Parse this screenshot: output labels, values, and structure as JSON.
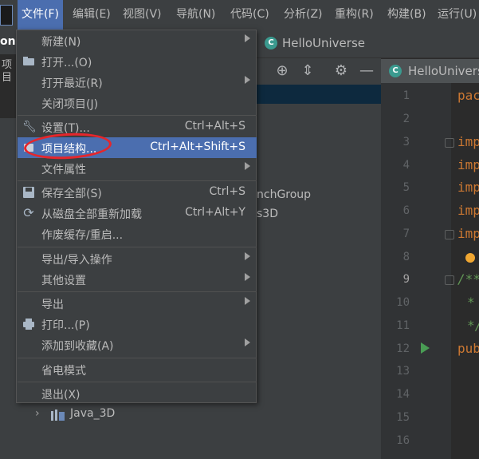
{
  "menubar": {
    "items": [
      "文件(F)",
      "编辑(E)",
      "视图(V)",
      "导航(N)",
      "代码(C)",
      "分析(Z)",
      "重构(R)",
      "构建(B)",
      "运行(U)"
    ],
    "active_index": 0
  },
  "left_strip": {
    "on_label": "on",
    "tab_label": "项目"
  },
  "top_tab": {
    "label": "HelloUniverse"
  },
  "editor_tab": {
    "label": "HelloUniverse"
  },
  "tree": {
    "group_label": "nchGroup",
    "s3d_label": "s3D",
    "java3d_label": "Java_3D"
  },
  "editor": {
    "line_numbers": [
      "1",
      "2",
      "3",
      "4",
      "5",
      "6",
      "7",
      "8",
      "9",
      "10",
      "11",
      "12",
      "13",
      "14",
      "15",
      "16"
    ],
    "current_line": "9",
    "lines": {
      "l1": "pac",
      "l3": "imp",
      "l4": "imp",
      "l5": "imp",
      "l6": "imp",
      "l7": "imp",
      "l9": "/**",
      "l10": "*",
      "l11": "*/",
      "l12": "pub"
    }
  },
  "file_menu": {
    "items": [
      {
        "label": "新建(N)",
        "shortcut": "",
        "submenu": true,
        "icon": ""
      },
      {
        "label": "打开...(O)",
        "shortcut": "",
        "submenu": false,
        "icon": "folder-icon"
      },
      {
        "label": "打开最近(R)",
        "shortcut": "",
        "submenu": true,
        "icon": ""
      },
      {
        "label": "关闭项目(J)",
        "shortcut": "",
        "submenu": false,
        "icon": ""
      },
      {
        "label": "设置(T)...",
        "shortcut": "Ctrl+Alt+S",
        "submenu": false,
        "icon": "wrench-icon"
      },
      {
        "label": "项目结构...",
        "shortcut": "Ctrl+Alt+Shift+S",
        "submenu": false,
        "icon": "project-structure-icon"
      },
      {
        "label": "文件属性",
        "shortcut": "",
        "submenu": true,
        "icon": ""
      },
      {
        "label": "保存全部(S)",
        "shortcut": "Ctrl+S",
        "submenu": false,
        "icon": "save-icon"
      },
      {
        "label": "从磁盘全部重新加载",
        "shortcut": "Ctrl+Alt+Y",
        "submenu": false,
        "icon": "reload-icon"
      },
      {
        "label": "作废缓存/重启...",
        "shortcut": "",
        "submenu": false,
        "icon": ""
      },
      {
        "label": "导出/导入操作",
        "shortcut": "",
        "submenu": true,
        "icon": ""
      },
      {
        "label": "其他设置",
        "shortcut": "",
        "submenu": true,
        "icon": ""
      },
      {
        "label": "导出",
        "shortcut": "",
        "submenu": true,
        "icon": ""
      },
      {
        "label": "打印...(P)",
        "shortcut": "",
        "submenu": false,
        "icon": "print-icon"
      },
      {
        "label": "添加到收藏(A)",
        "shortcut": "",
        "submenu": true,
        "icon": ""
      },
      {
        "label": "省电模式",
        "shortcut": "",
        "submenu": false,
        "icon": ""
      },
      {
        "label": "退出(X)",
        "shortcut": "",
        "submenu": false,
        "icon": ""
      }
    ]
  },
  "colors": {
    "highlight": "#4b6eaf",
    "annotation_circle": "#e5262b",
    "keyword": "#cc7832",
    "comment": "#629755"
  }
}
